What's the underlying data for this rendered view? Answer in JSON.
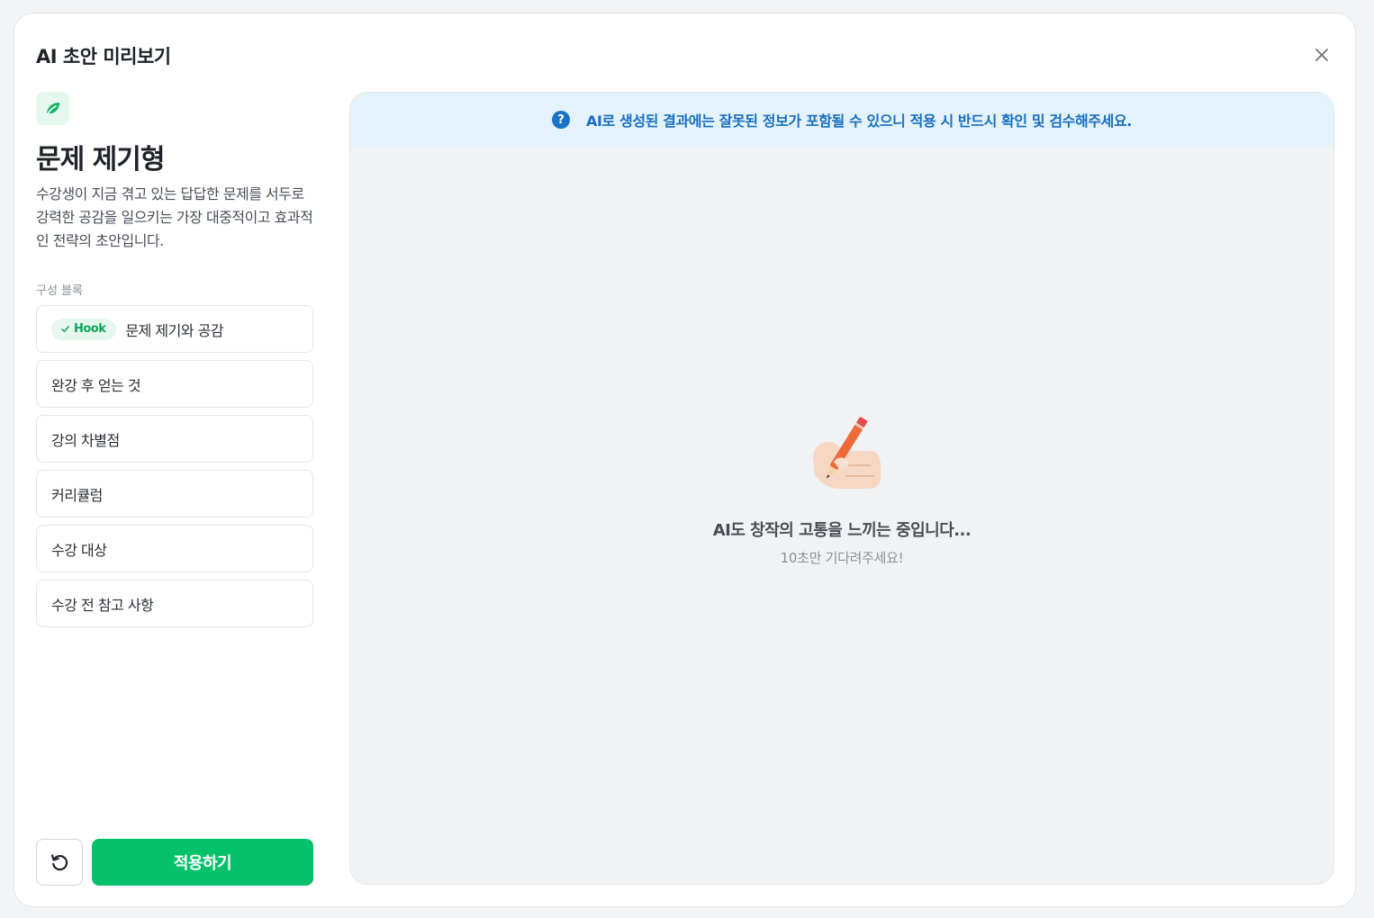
{
  "modal": {
    "title": "AI 초안 미리보기",
    "close_icon": "close-icon"
  },
  "template": {
    "icon": "leaf-icon",
    "title": "문제 제기형",
    "description": "수강생이 지금 겪고 있는 답답한 문제를 서두로 강력한 공감을 일으키는 가장 대중적이고 효과적인 전략의 초안입니다.",
    "blocks_label": "구성 블록",
    "blocks": [
      {
        "tag": "Hook",
        "label": "문제 제기와 공감",
        "checked": true
      },
      {
        "label": "완강 후 얻는 것"
      },
      {
        "label": "강의 차별점"
      },
      {
        "label": "커리큘럼"
      },
      {
        "label": "수강 대상"
      },
      {
        "label": "수강 전 참고 사항"
      }
    ],
    "reset_icon": "reset-icon",
    "apply_label": "적용하기"
  },
  "preview": {
    "notice": "AI로 생성된 결과에는 잘못된 정보가 포함될 수 있으니 적용 시 반드시 확인 및 검수해주세요.",
    "notice_icon": "question-icon",
    "loading_illustration": "writing-hand-icon",
    "loading_title": "AI도 창작의 고통을 느끼는 중입니다...",
    "loading_subtitle": "10초만 기다려주세요!"
  },
  "colors": {
    "accent": "#05c16a",
    "accent_soft": "#e6f7ee",
    "notice_bg": "#e3f2fb",
    "notice_text": "#1a6fc0"
  }
}
